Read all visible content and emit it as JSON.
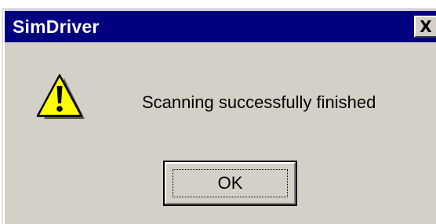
{
  "window": {
    "title": "SimDriver",
    "close_label": "X"
  },
  "dialog": {
    "icon": "warning-icon",
    "message": "Scanning successfully finished",
    "ok_label": "OK"
  },
  "colors": {
    "titlebar": "#000080",
    "dialog_background": "#d4d0c8",
    "warning_fill": "#ffff00"
  }
}
